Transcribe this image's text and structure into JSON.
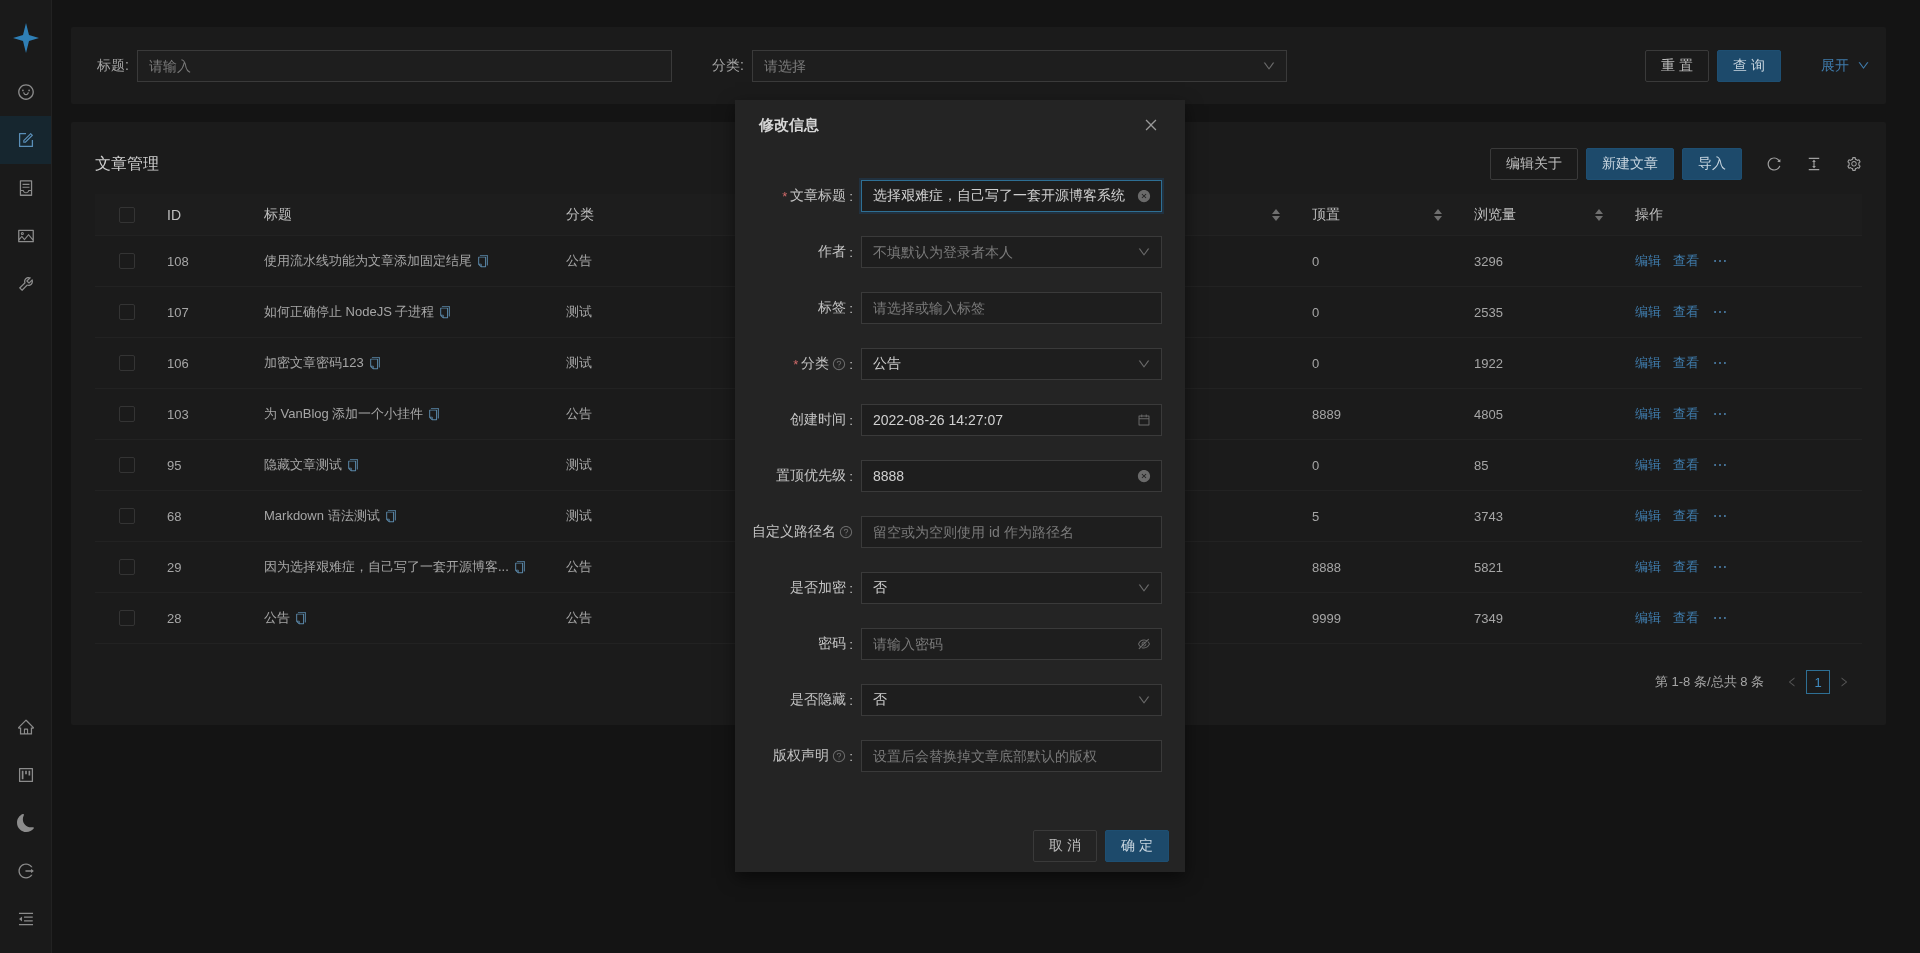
{
  "sidebar": {
    "items": [
      {
        "selected": false
      },
      {
        "selected": true
      },
      {
        "selected": false
      },
      {
        "selected": false
      },
      {
        "selected": false
      }
    ]
  },
  "search_form": {
    "fields": [
      {
        "label": "标题:",
        "kind": "input",
        "placeholder": "请输入"
      },
      {
        "label": "分类:",
        "kind": "select",
        "placeholder": "请选择"
      }
    ],
    "buttons": [
      {
        "label": "重 置",
        "kind": "default"
      },
      {
        "label": "查 询",
        "kind": "primary"
      }
    ],
    "expand_link": "展开"
  },
  "table_card": {
    "title": "文章管理",
    "toolbar": [
      {
        "label": "编辑关于",
        "kind": "default"
      },
      {
        "label": "新建文章",
        "kind": "primary"
      },
      {
        "label": "导入",
        "kind": "primary"
      }
    ],
    "select_all": {
      "checked": false
    },
    "columns": [
      {
        "label": "ID",
        "sortable": false
      },
      {
        "label": "标题",
        "sortable": false
      },
      {
        "label": "分类",
        "sortable": false
      },
      {
        "sortable": true
      },
      {
        "label": "顶置",
        "sortable": true
      },
      {
        "label": "浏览量",
        "sortable": true
      },
      {
        "label": "操作",
        "sortable": false
      }
    ],
    "rows": [
      {
        "checked": false,
        "id": "108",
        "title": "使用流水线功能为文章添加固定结尾",
        "category": "公告",
        "pinned": "0",
        "views": "3296",
        "actions": [
          "编辑",
          "查看"
        ]
      },
      {
        "checked": false,
        "id": "107",
        "title": "如何正确停止 NodeJS 子进程",
        "category": "测试",
        "pinned": "0",
        "views": "2535",
        "actions": [
          "编辑",
          "查看"
        ]
      },
      {
        "checked": false,
        "id": "106",
        "title": "加密文章密码123",
        "category": "测试",
        "pinned": "0",
        "views": "1922",
        "actions": [
          "编辑",
          "查看"
        ]
      },
      {
        "checked": false,
        "id": "103",
        "title": "为 VanBlog 添加一个小挂件",
        "category": "公告",
        "pinned": "8889",
        "views": "4805",
        "actions": [
          "编辑",
          "查看"
        ]
      },
      {
        "checked": false,
        "id": "95",
        "title": "隐藏文章测试",
        "category": "测试",
        "pinned": "0",
        "views": "85",
        "actions": [
          "编辑",
          "查看"
        ]
      },
      {
        "checked": false,
        "id": "68",
        "title": "Markdown 语法测试",
        "category": "测试",
        "pinned": "5",
        "views": "3743",
        "actions": [
          "编辑",
          "查看"
        ]
      },
      {
        "checked": false,
        "id": "29",
        "title": "因为选择艰难症，自己写了一套开源博客...",
        "category": "公告",
        "pinned": "8888",
        "views": "5821",
        "actions": [
          "编辑",
          "查看"
        ]
      },
      {
        "checked": false,
        "id": "28",
        "title": "公告",
        "category": "公告",
        "pinned": "9999",
        "views": "7349",
        "actions": [
          "编辑",
          "查看"
        ]
      }
    ],
    "pagination": {
      "summary": "第 1-8 条/总共 8 条",
      "pages": [
        {
          "label": "1",
          "selected": true
        }
      ]
    }
  },
  "modal": {
    "title": "修改信息",
    "fields": [
      {
        "label": "文章标题",
        "colon": ":",
        "required_mark": "*",
        "help": false,
        "kind": "input",
        "value": "选择艰难症，自己写了一套开源博客系统",
        "focused": true,
        "clearable": true
      },
      {
        "label": "作者",
        "colon": ":",
        "help": false,
        "kind": "select",
        "placeholder": "不填默认为登录者本人",
        "focused": false,
        "clearable": false
      },
      {
        "label": "标签",
        "colon": ":",
        "help": false,
        "kind": "input",
        "placeholder": "请选择或输入标签",
        "focused": false,
        "clearable": false
      },
      {
        "label": "分类",
        "colon": ":",
        "required_mark": "*",
        "help": true,
        "kind": "select",
        "value": "公告",
        "focused": false,
        "clearable": false
      },
      {
        "label": "创建时间",
        "colon": ":",
        "help": false,
        "kind": "date",
        "value": "2022-08-26 14:27:07",
        "focused": false,
        "clearable": false
      },
      {
        "label": "置顶优先级",
        "colon": ":",
        "help": false,
        "kind": "input",
        "value": "8888",
        "focused": false,
        "clearable": true
      },
      {
        "label": "自定义路径名",
        "help": true,
        "kind": "input",
        "placeholder": "留空或为空则使用 id 作为路径名",
        "focused": false,
        "clearable": false
      },
      {
        "label": "是否加密",
        "colon": ":",
        "help": false,
        "kind": "select",
        "value": "否",
        "focused": false,
        "clearable": false
      },
      {
        "label": "密码",
        "colon": ":",
        "help": false,
        "kind": "password",
        "placeholder": "请输入密码",
        "focused": false,
        "clearable": false
      },
      {
        "label": "是否隐藏",
        "colon": ":",
        "help": false,
        "kind": "select",
        "value": "否",
        "focused": false,
        "clearable": false
      },
      {
        "label": "版权声明",
        "colon": ":",
        "help": true,
        "kind": "input",
        "placeholder": "设置后会替换掉文章底部默认的版权",
        "focused": false,
        "clearable": false
      }
    ],
    "buttons": [
      {
        "label": "取 消",
        "kind": "default"
      },
      {
        "label": "确 定",
        "kind": "primary"
      }
    ]
  }
}
